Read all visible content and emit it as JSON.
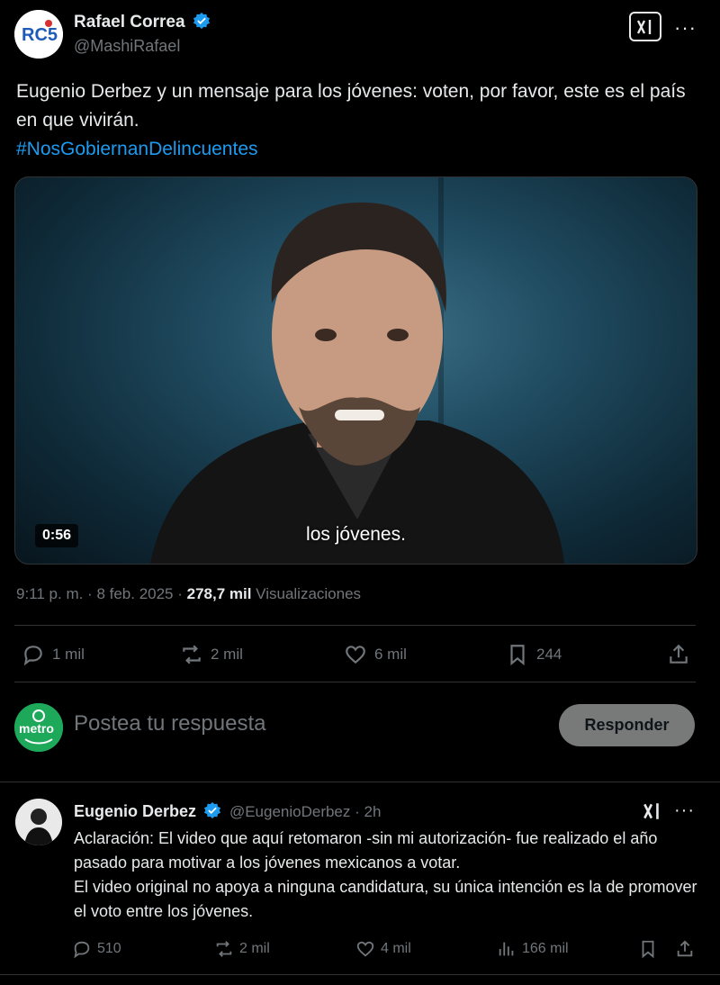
{
  "tweet": {
    "author_name": "Rafael Correa",
    "author_handle": "@MashiRafael",
    "avatar_label": "RC5",
    "text": "Eugenio Derbez y un mensaje para los jóvenes: voten, por favor, este es el país en que vivirán.",
    "hashtag": "#NosGobiernanDelincuentes",
    "video": {
      "duration": "0:56",
      "subtitle": "los jóvenes."
    },
    "timestamp": "9:11 p. m. · 8 feb. 2025 · ",
    "views_count": "278,7 mil",
    "views_label": " Visualizaciones",
    "actions": {
      "replies": "1 mil",
      "reposts": "2 mil",
      "likes": "6 mil",
      "bookmarks": "244"
    }
  },
  "compose": {
    "avatar_label": "metro",
    "placeholder": "Postea tu respuesta",
    "button_label": "Responder"
  },
  "reply": {
    "author_name": "Eugenio Derbez",
    "author_handle": "@EugenioDerbez",
    "time": " · 2h",
    "text": "Aclaración: El video que aquí retomaron -sin mi autorización- fue realizado el año pasado para motivar a los jóvenes mexicanos a votar.\nEl video original no apoya a ninguna candidatura, su única intención es la de promover el voto entre los jóvenes.",
    "actions": {
      "replies": "510",
      "reposts": "2 mil",
      "likes": "4 mil",
      "views": "166 mil"
    }
  },
  "colors": {
    "accent": "#1d9bf0",
    "background": "#000000",
    "muted": "#71767b"
  }
}
